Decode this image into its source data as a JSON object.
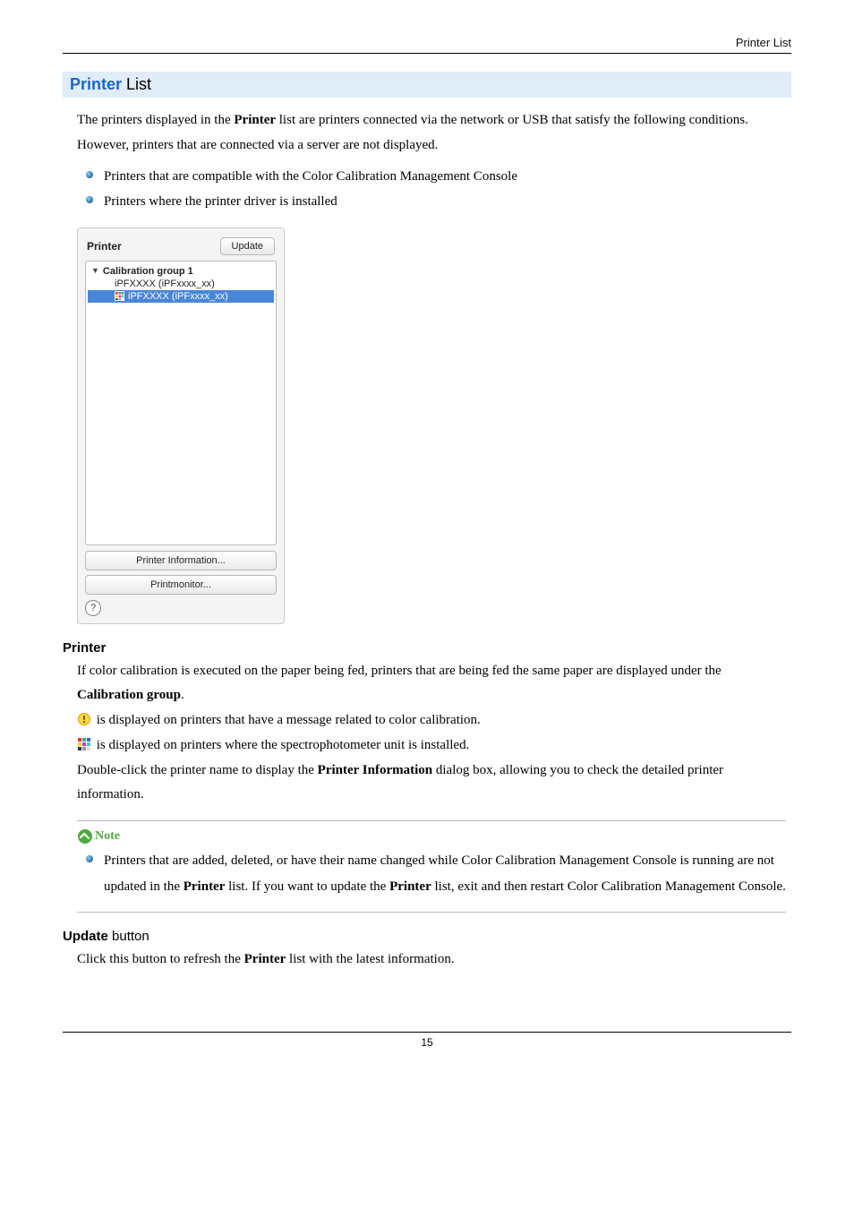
{
  "header": {
    "right": "Printer List"
  },
  "title": {
    "accent": "Printer",
    "rest": " List"
  },
  "intro": {
    "part1": "The printers displayed in the ",
    "bold1": "Printer",
    "part2": " list are printers connected via the network or USB that satisfy the following conditions. However, printers that are connected via a server are not displayed."
  },
  "bullets": {
    "b1": "Printers that are compatible with the Color Calibration Management Console",
    "b2": "Printers where the printer driver is installed"
  },
  "panel": {
    "title": "Printer",
    "update": "Update",
    "group": "Calibration group 1",
    "row1": "iPFXXXX (iPFxxxx_xx)",
    "row2": "iPFXXXX (iPFxxxx_xx)",
    "info": "Printer Information...",
    "monitor": "Printmonitor...",
    "help": "?"
  },
  "printer_section": {
    "heading": "Printer",
    "line1a": "If color calibration is executed on the paper being fed, printers that are being fed the same paper are displayed under the ",
    "line1b": "Calibration group",
    "line1c": ".",
    "warn_line": " is displayed on printers that have a message related to color calibration.",
    "spectro_line": " is displayed on printers where the spectrophotometer unit is installed.",
    "dbl1": "Double-click the printer name to display the ",
    "dbl_bold": "Printer Information",
    "dbl2": " dialog box, allowing you to check the detailed printer information."
  },
  "note": {
    "label": "Note",
    "t1": "Printers that are added, deleted, or have their name changed while Color Calibration Management Console is running are not updated in the ",
    "b1": "Printer",
    "t2": " list. If you want to update the ",
    "b2": "Printer",
    "t3": " list, exit and then restart Color Calibration Management Console."
  },
  "update_section": {
    "head_bold": "Update",
    "head_rest": " button",
    "t1": "Click this button to refresh the ",
    "b1": "Printer",
    "t2": " list with the latest information."
  },
  "footer": {
    "page_number": "15"
  }
}
